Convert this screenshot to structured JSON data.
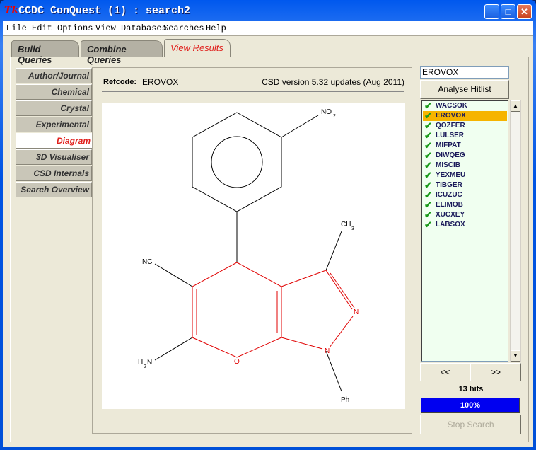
{
  "window": {
    "title": "CCDC ConQuest (1) : search2",
    "app_icon": "Tk"
  },
  "menu": [
    "File",
    "Edit",
    "Options",
    "View Databases",
    "Searches",
    "Help"
  ],
  "tabs": [
    "Build Queries",
    "Combine Queries",
    "View Results"
  ],
  "active_tab": "View Results",
  "nav": [
    "Author/Journal",
    "Chemical",
    "Crystal",
    "Experimental",
    "Diagram",
    "3D Visualiser",
    "CSD Internals",
    "Search Overview"
  ],
  "active_nav": "Diagram",
  "header": {
    "refcode_label": "Refcode:",
    "refcode": "EROVOX",
    "csd_version": "CSD version 5.32 updates (Aug 2011)"
  },
  "diagram": {
    "labels": {
      "no2": "NO",
      "no2_sub": "2",
      "ch3": "CH",
      "ch3_sub": "3",
      "nc": "NC",
      "h2n_h": "H",
      "h2n_sub": "2",
      "h2n_n": "N",
      "o": "O",
      "n2": "N",
      "n1": "N",
      "ph": "Ph"
    },
    "colors": {
      "ring": "#e00000",
      "bond": "#000000"
    }
  },
  "search": {
    "value": "EROVOX"
  },
  "analyse_button": "Analyse Hitlist",
  "hits": [
    "WACSOK",
    "EROVOX",
    "QOZFER",
    "LULSER",
    "MIFPAT",
    "DIWQEG",
    "MISCIB",
    "YEXMEU",
    "TIBGER",
    "ICUZUC",
    "ELIMOB",
    "XUCXEY",
    "LABSOX"
  ],
  "selected_hit": "EROVOX",
  "prev_button": "<<",
  "next_button": ">>",
  "hit_count": "13 hits",
  "progress": {
    "label": "100%",
    "value": 100
  },
  "stop_button": "Stop Search"
}
